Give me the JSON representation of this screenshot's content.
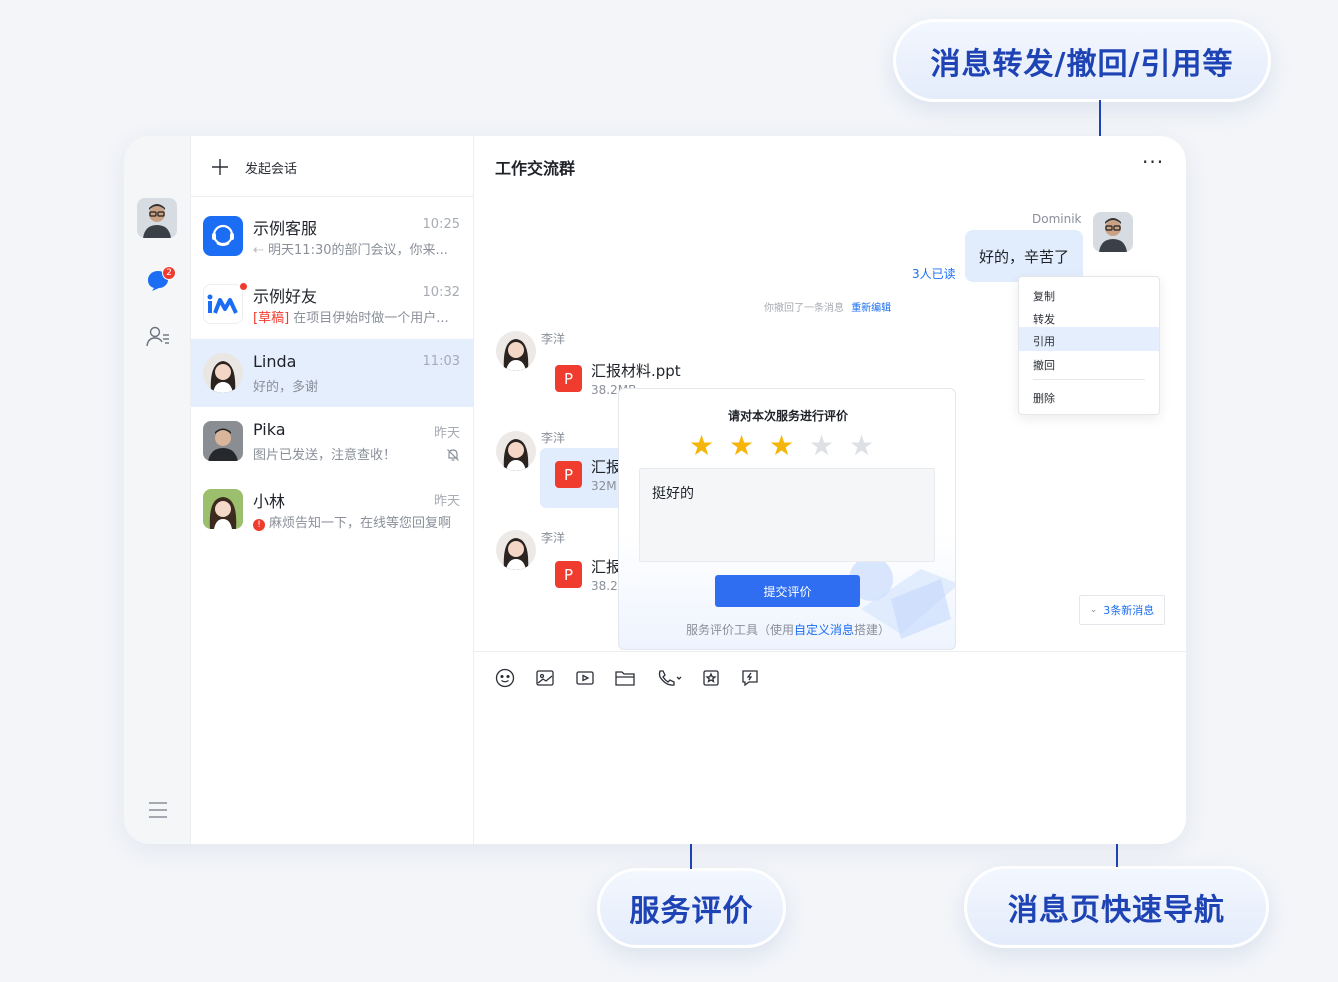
{
  "callouts": {
    "top": "消息转发/撤回/引用等",
    "service": "服务评价",
    "nav": "消息页快速导航"
  },
  "rail": {
    "unread_badge": "2"
  },
  "conv_header": {
    "new_chat": "发起会话"
  },
  "conversations": [
    {
      "name": "示例客服",
      "time": "10:25",
      "preview": "明天11:30的部门会议，你来..."
    },
    {
      "name": "示例好友",
      "time": "10:32",
      "draft_tag": "[草稿]",
      "preview": "在项目伊始时做一个用户..."
    },
    {
      "name": "Linda",
      "time": "11:03",
      "preview": "好的，多谢"
    },
    {
      "name": "Pika",
      "time": "昨天",
      "preview": "图片已发送，注意查收！"
    },
    {
      "name": "小林",
      "time": "昨天",
      "preview": "麻烦告知一下，在线等您回复啊"
    }
  ],
  "chat": {
    "title": "工作交流群",
    "sender_me": "Dominik",
    "my_message": "好的，辛苦了",
    "read_receipt": "3人已读",
    "recall_notice": "你撤回了一条消息",
    "re_edit": "重新编辑",
    "sender_other": "李洋",
    "files": [
      {
        "name": "汇报材料.ppt",
        "size": "38.2MB"
      },
      {
        "name": "汇报",
        "size": "32M"
      },
      {
        "name": "汇报",
        "size": "38.2"
      }
    ],
    "file_icon": "P",
    "new_messages": "3条新消息"
  },
  "context_menu": [
    "复制",
    "转发",
    "引用",
    "撤回",
    "删除"
  ],
  "rating": {
    "title": "请对本次服务进行评价",
    "stars_filled": 3,
    "stars_total": 5,
    "comment": "挺好的",
    "submit": "提交评价",
    "footer_prefix": "服务评价工具（使用",
    "footer_link": "自定义消息",
    "footer_suffix": "搭建）"
  },
  "toolbar_icons": [
    "emoji-icon",
    "image-icon",
    "video-icon",
    "folder-icon",
    "call-icon",
    "star-card-icon",
    "custom-message-icon"
  ],
  "colors": {
    "accent": "#1e43b4",
    "brand": "#1b6ef3",
    "star": "#f5b50a",
    "selected": "#e5eefc",
    "danger": "#f03c2f"
  }
}
